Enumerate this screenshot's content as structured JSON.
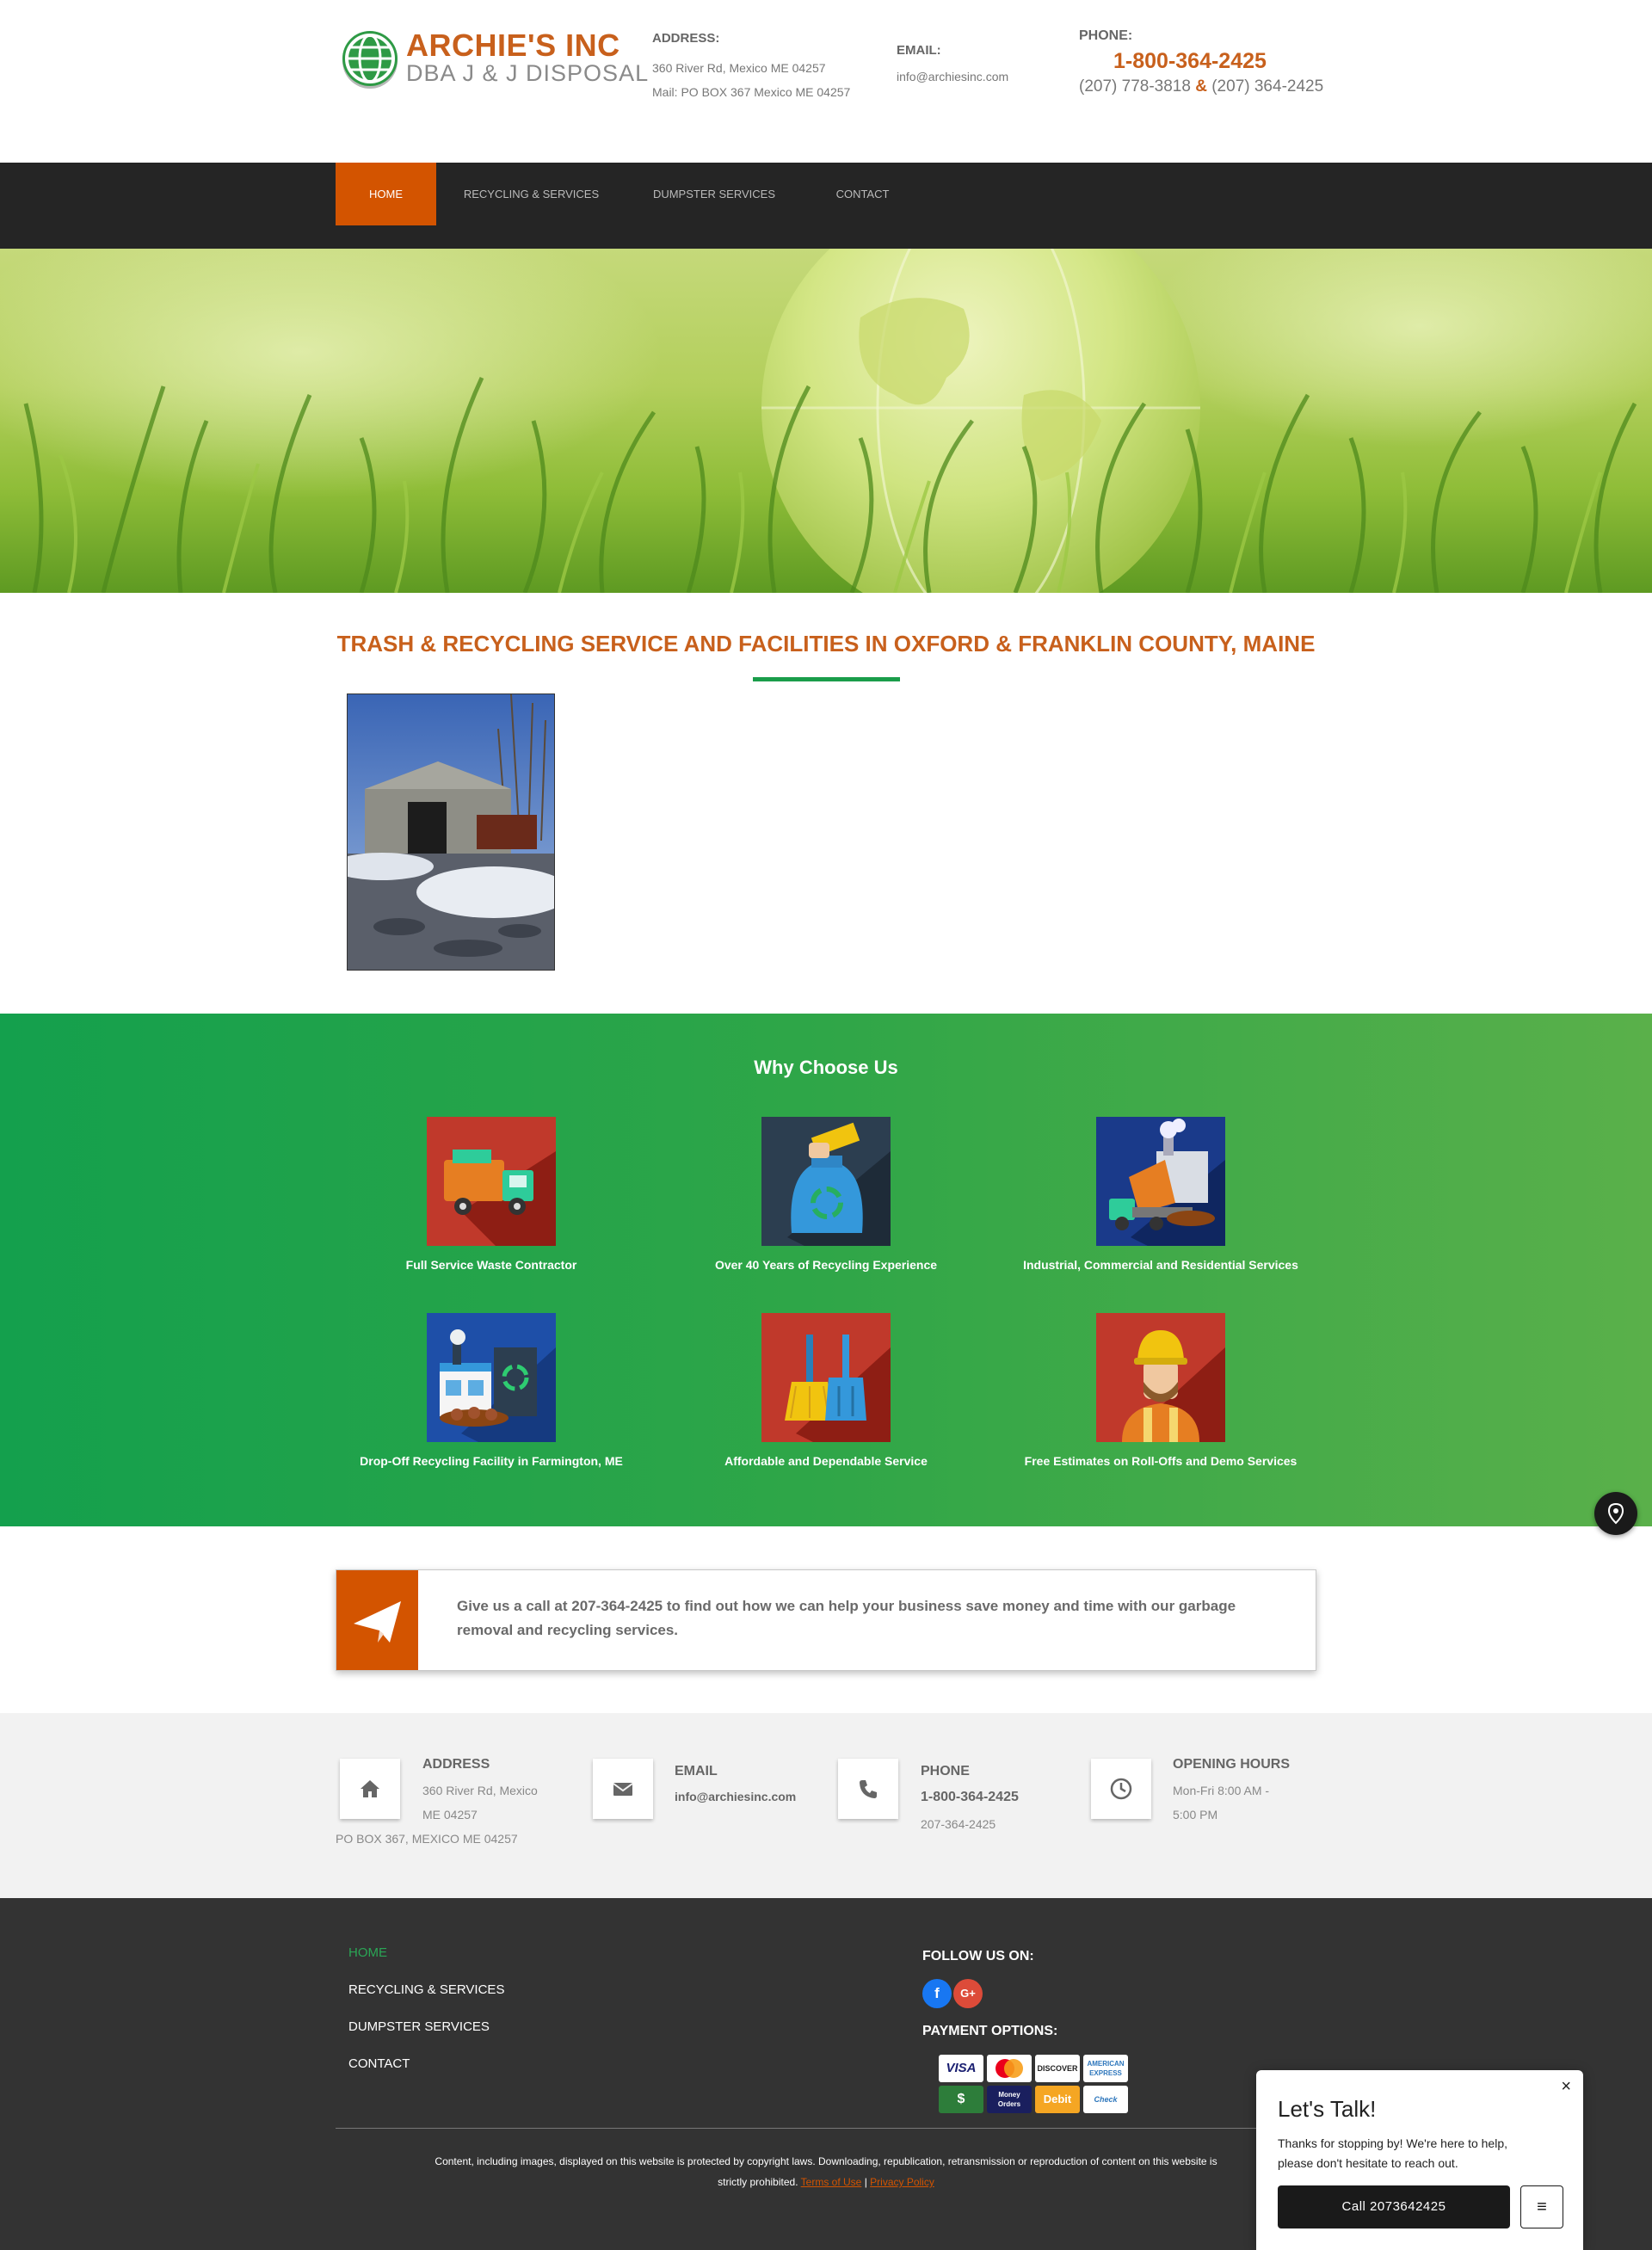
{
  "header": {
    "logo_name": "ARCHIE'S INC",
    "logo_sub": "DBA J & J DISPOSAL",
    "address_label": "ADDRESS:",
    "address_line1": "360 River Rd, Mexico ME 04257",
    "address_line2": "Mail: PO BOX 367 Mexico ME 04257",
    "email_label": "EMAIL:",
    "email": "info@archiesinc.com",
    "phone_label": "PHONE:",
    "phone_main": "1-800-364-2425",
    "phone_alt1": "(207) 778-3818",
    "phone_amp": "&",
    "phone_alt2": "(207) 364-2425"
  },
  "nav": {
    "items": [
      {
        "label": "HOME"
      },
      {
        "label": "RECYCLING & SERVICES"
      },
      {
        "label": "DUMPSTER SERVICES"
      },
      {
        "label": "CONTACT"
      }
    ]
  },
  "main": {
    "title": "TRASH & RECYCLING SERVICE AND FACILITIES IN OXFORD & FRANKLIN COUNTY, MAINE"
  },
  "why": {
    "title": "Why Choose Us",
    "features": [
      {
        "label": "Full Service Waste Contractor",
        "icon": "garbage-truck-icon",
        "color": "#c0392b"
      },
      {
        "label": "Over 40 Years of Recycling Experience",
        "icon": "recycling-bag-icon",
        "color": "#2c3e50"
      },
      {
        "label": "Industrial, Commercial and Residential Services",
        "icon": "dump-truck-factory-icon",
        "color": "#1a3a8a"
      },
      {
        "label": "Drop-Off Recycling Facility in Farmington, ME",
        "icon": "recycling-facility-icon",
        "color": "#1e4fa8"
      },
      {
        "label": "Affordable and Dependable Service",
        "icon": "broom-dustpan-icon",
        "color": "#c0392b"
      },
      {
        "label": "Free Estimates on Roll-Offs and Demo Services",
        "icon": "worker-icon",
        "color": "#c0392b"
      }
    ]
  },
  "callout": {
    "text": "Give us a call at 207-364-2425 to find out how we can help your business save money and time with our garbage removal and recycling services."
  },
  "contact": {
    "address_title": "ADDRESS",
    "address_line1": "360 River Rd, Mexico",
    "address_line2": "ME 04257",
    "address_line3": "PO BOX 367, MEXICO ME 04257",
    "email_title": "EMAIL",
    "email": "info@archiesinc.com",
    "phone_title": "PHONE",
    "phone_main": "1-800-364-2425",
    "phone_alt": "207-364-2425",
    "hours_title": "OPENING HOURS",
    "hours_line1": "Mon-Fri 8:00 AM -",
    "hours_line2": "5:00 PM"
  },
  "footer": {
    "nav": [
      "HOME",
      "RECYCLING & SERVICES",
      "DUMPSTER SERVICES",
      "CONTACT"
    ],
    "follow_label": "FOLLOW US ON:",
    "payment_label": "PAYMENT OPTIONS:",
    "payments": [
      "VISA",
      "MasterCard",
      "DISCOVER",
      "AMERICAN EXPRESS",
      "$",
      "Money Orders",
      "Debit",
      "Check"
    ],
    "copyright": "Content, including images, displayed on this website is protected by copyright laws. Downloading, republication, retransmission or reproduction of content on this website is strictly prohibited.",
    "terms": "Terms of Use",
    "separator": "|",
    "privacy": "Privacy Policy"
  },
  "chat": {
    "close": "×",
    "title": "Let's Talk!",
    "text": "Thanks for stopping by! We're here to help, please don't hesitate to reach out.",
    "button": "Call 2073642425",
    "menu": "≡"
  },
  "colors": {
    "brand_orange": "#d35400",
    "brand_green": "#1a9d4a",
    "nav_bg": "#252525",
    "footer_bg": "#333333"
  }
}
